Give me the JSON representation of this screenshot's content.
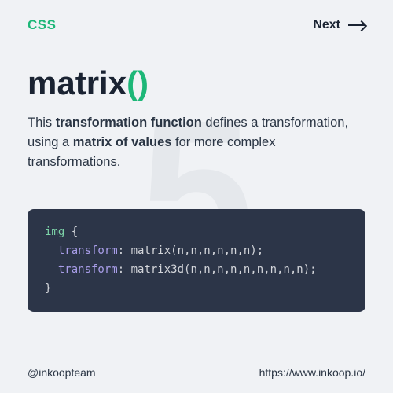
{
  "header": {
    "label": "CSS",
    "next_label": "Next"
  },
  "bg_number": "5",
  "title": {
    "name": "matrix",
    "parens": "()"
  },
  "description": {
    "part1": "This ",
    "bold1": "transformation function",
    "part2": " defines a transformation, using a ",
    "bold2": "matrix of values",
    "part3": " for more complex transformations."
  },
  "code": {
    "selector": "img",
    "open_brace": " {",
    "line1_prop": "  transform",
    "line1_val": " matrix(n,n,n,n,n,n);",
    "line2_prop": "  transform",
    "line2_val": " matrix3d(n,n,n,n,n,n,n,n,n);",
    "close_brace": "}"
  },
  "footer": {
    "handle": "@inkoopteam",
    "url": "https://www.inkoop.io/"
  }
}
